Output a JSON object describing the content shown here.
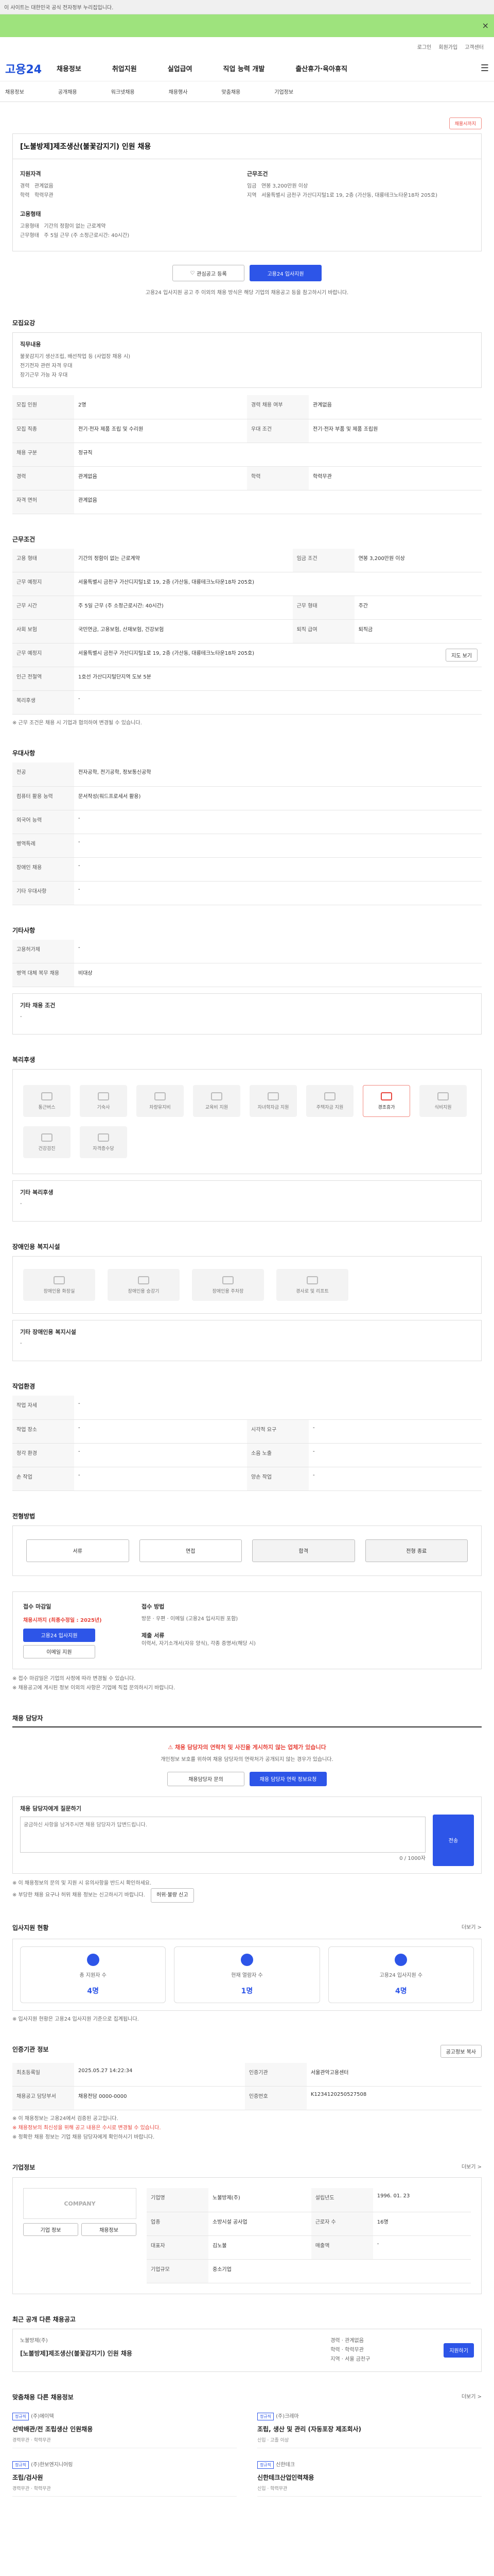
{
  "browser": {
    "notice": "이 사이트는 대한민국 공식 전자정부 누리집입니다."
  },
  "util": {
    "login": "로그인",
    "join": "회원가입",
    "center": "고객센터"
  },
  "header": {
    "logo": "고용24",
    "gnb": [
      "채용정보",
      "취업지원",
      "실업급여",
      "직업 능력 개발",
      "출산휴가·육아휴직"
    ]
  },
  "subnav": [
    "채용정보",
    "공개채용",
    "워크넷채용",
    "채용행사",
    "맞춤채용",
    "기업정보"
  ],
  "job": {
    "badge": "채용시까지",
    "title": "[노불방제]제조생산(불꽃감지기) 인원 채용",
    "req_title": "지원자격",
    "req": [
      [
        "경력",
        "관계없음"
      ],
      [
        "학력",
        "학력무관"
      ]
    ],
    "cond_title": "근무조건",
    "cond": [
      [
        "임금",
        "연봉 3,200만원 이상"
      ],
      [
        "지역",
        "서울특별시 금천구 가산디지털1로 19, 2층 (가산동, 대륭테크노타운18차 205호)"
      ]
    ],
    "type_title": "고용형태",
    "type": [
      [
        "고용형태",
        "기간의 정함이 없는 근로계약"
      ],
      [
        "근무형태",
        "주 5일 근무 (주 소정근로시간: 40시간)"
      ]
    ],
    "scrap": "관심공고 등록",
    "apply": "고용24 입사지원",
    "notice": "고용24 입사지원 공고 주 이외의 채용 방식은 해당 기업의 채용공고 등을 참고하시기 바랍니다."
  },
  "recruit": {
    "title": "모집요강",
    "duty_title": "직무내용",
    "duty": "불꽃감지기 생산조립, 배선작업 등 (사업장 채용 시)\n전기전자 관련 자격 우대\n장기근무 가능 자 우대",
    "rows": [
      [
        "모집 인원",
        "2명",
        "경력 채용 여부",
        "관계없음"
      ],
      [
        "모집 직종",
        "전기·전자 제품 조립 및 수리원",
        "우대 조건",
        "전기·전자 부품 및 제품 조립원"
      ],
      [
        "채용 구분",
        "정규직",
        "",
        ""
      ],
      [
        "경력",
        "관계없음",
        "학력",
        "학력무관"
      ],
      [
        "자격 면허",
        "관계없음",
        "",
        ""
      ]
    ]
  },
  "work": {
    "title": "근무조건",
    "rows": [
      [
        "고용 형태",
        "기간의 정함이 없는 근로계약",
        "임금 조건",
        "연봉 3,200만원 이상"
      ],
      [
        "근무 예정지",
        "서울특별시 금천구 가산디지털1로 19, 2층 (가산동, 대륭테크노타운18차 205호)",
        "",
        ""
      ],
      [
        "근무 시간",
        "주 5일 근무 (주 소정근로시간: 40시간)",
        "근무 형태",
        "주간"
      ],
      [
        "사회 보험",
        "국민연금, 고용보험, 산재보험, 건강보험",
        "퇴직 급여",
        "퇴직금"
      ],
      [
        "근무 예정지",
        "서울특별시 금천구 가산디지털1로 19, 2층 (가산동, 대륭테크노타운18차 205호)",
        "",
        ""
      ],
      [
        "인근 전철역",
        "1호선 가산디지털단지역 도보 5분",
        "",
        ""
      ],
      [
        "복리후생",
        "-",
        "",
        ""
      ]
    ],
    "map_btn": "지도 보기",
    "note": "※ 근무 조건은 채용 시 기업과 협의하여 변경될 수 있습니다."
  },
  "prefer": {
    "title": "우대사항",
    "rows": [
      [
        "전공",
        "전자공학, 전기공학, 정보통신공학"
      ],
      [
        "컴퓨터 활용 능력",
        "문서작성(워드프로세서 활용)"
      ],
      [
        "외국어 능력",
        "-"
      ],
      [
        "병역특례",
        "-"
      ],
      [
        "장애인 채용",
        "-"
      ],
      [
        "기타 우대사항",
        "-"
      ]
    ]
  },
  "other": {
    "title": "기타사항",
    "rows": [
      [
        "고용허가제",
        "-"
      ],
      [
        "병역 대체 복무 채용",
        "비대상"
      ]
    ],
    "cond_label": "기타 채용 조건",
    "cond": "-"
  },
  "welfare": {
    "title": "복리후생",
    "items": [
      "통근버스",
      "기숙사",
      "차량유지비",
      "교육비 지원",
      "자녀학자금 지원",
      "주택자금 지원",
      "경조휴가",
      "식비지원",
      "건강검진",
      "자격증수당"
    ],
    "active_index": 6,
    "etc_label": "기타 복리후생",
    "etc": "-"
  },
  "disability": {
    "title": "장애인용 복지시설",
    "items": [
      "장애인용 화장실",
      "장애인용 승강기",
      "장애인용 주차장",
      "경사로 및 리프트"
    ],
    "etc_label": "기타 장애인용 복지시설",
    "etc": "-"
  },
  "workenv": {
    "title": "작업환경",
    "rows": [
      [
        "작업 자세",
        "-",
        "",
        ""
      ],
      [
        "작업 장소",
        "-",
        "시각적 요구",
        "-"
      ],
      [
        "청각 환경",
        "-",
        "소음 노출",
        "-"
      ],
      [
        "손 작업",
        "-",
        "양손 작업",
        "-"
      ]
    ]
  },
  "selection": {
    "title": "전형방법",
    "steps": [
      "서류",
      "면접",
      "합격",
      "전형 종료"
    ]
  },
  "apply_info": {
    "title1": "접수 마감일",
    "deadline": "채용시까지 (최종수정일 : 2025년)",
    "btn1": "고용24 입사지원",
    "btn2": "이메일 지원",
    "title2": "접수 방법",
    "methods": [
      "방문",
      "우편",
      "이메일 (고용24 입사지원 포함)"
    ],
    "title3": "제출 서류",
    "docs": "이력서, 자기소개서(자유 양식), 각종 증명서(해당 시)",
    "notes": [
      "※ 접수 마감일은 기업의 사정에 따라 변경될 수 있습니다.",
      "※ 채용공고에 게시된 정보 이외의 사항은 기업에 직접 문의하시기 바랍니다."
    ]
  },
  "contact": {
    "title": "채용 담당자",
    "warning": "채용 담당자의 연락처 및 사진을 게시하지 않는 업체가 있습니다",
    "sub": "개인정보 보호를 위하여 채용 담당자의 연락처가 공개되지 않는 경우가 있습니다.",
    "btn1": "채용담당자 문의",
    "btn2": "채용 담당자 연락 정보요청",
    "qa_label": "채용 담당자에게 질문하기",
    "qa_placeholder": "궁금하신 사항을 남겨주시면 채용 담당자가 답변드립니다.",
    "qa_btn": "전송",
    "counter": "0 / 1000자",
    "notes": [
      "※ 이 채용정보의 문의 및 지원 시 유의사항을 반드시 확인하세요.",
      "※ 부당한 채용 요구나 허위 채용 정보는 신고하시기 바랍니다."
    ],
    "report": "허위·불량 신고"
  },
  "stats": {
    "title": "입사지원 현황",
    "more": "더보기 >",
    "items": [
      [
        "총 지원자 수",
        "4명"
      ],
      [
        "현재 열람자 수",
        "1명"
      ],
      [
        "고용24 입사지원 수",
        "4명"
      ]
    ],
    "note": "※ 입사지원 현황은 고용24 입사지원 기준으로 집계됩니다."
  },
  "manage": {
    "title": "인증기관 정보",
    "btn": "공고정보 복사",
    "rows": [
      [
        "최초등록일",
        "2025.05.27 14:22:34",
        "인증기관",
        "서울관악고용센터"
      ],
      [
        "채용공고 담당부서",
        "채용전담 0000-0000",
        "인증번호",
        "K1234120250527508"
      ]
    ],
    "notes": [
      "※ 이 채용정보는 고용24에서 검증된 공고입니다.",
      "※ 채용정보의 최신성을 위해 공고 내용은 수시로 변경될 수 있습니다.",
      "※ 정확한 채용 정보는 기업 채용 담당자에게 확인하시기 바랍니다."
    ]
  },
  "company": {
    "title": "기업정보",
    "more": "더보기 >",
    "logo": "COMPANY",
    "rows": [
      [
        "기업명",
        "노불방제(주)",
        "설립년도",
        "1996. 01. 23"
      ],
      [
        "업종",
        "소방시설 공사업",
        "근로자 수",
        "16명"
      ],
      [
        "대표자",
        "김노불",
        "매출액",
        "-"
      ],
      [
        "기업규모",
        "중소기업",
        "",
        ""
      ]
    ],
    "btn1": "기업 정보",
    "btn2": "채용정보"
  },
  "related": {
    "title": "최근 공개 다른 채용공고",
    "item_title": "[노불방제]제조생산(불꽃감지기) 인원 채용",
    "item_org": "노불방제(주)",
    "meta": [
      [
        "경력",
        "관계없음"
      ],
      [
        "학력",
        "학력무관"
      ],
      [
        "지역",
        "서울 금천구"
      ]
    ],
    "btn": "지원하기"
  },
  "recommend": {
    "title": "맞춤채용 다른 채용정보",
    "more": "더보기 >",
    "items": [
      {
        "tag": "정규직",
        "company": "(주)에이텍",
        "title": "선박배관/전 조립생산 인원채용",
        "info": "경력무관 · 학력무관"
      },
      {
        "tag": "정규직",
        "company": "(주)크레마",
        "title": "조립, 생산 및 관리 (자동포장 제조회사)",
        "info": "신입 · 고졸 이상"
      },
      {
        "tag": "정규직",
        "company": "(주)한보엔지니어링",
        "title": "조립/검사원",
        "info": "경력무관 · 학력무관"
      },
      {
        "tag": "정규직",
        "company": "신한테크",
        "title": "신한테크산업인력채용",
        "info": "신입 · 학력무관"
      }
    ]
  }
}
